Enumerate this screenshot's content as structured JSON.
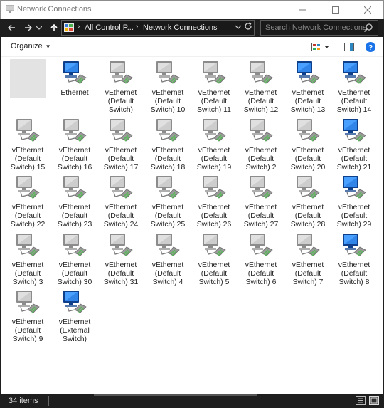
{
  "window": {
    "title": "Network Connections"
  },
  "addressbar": {
    "crumbs": [
      "All Control P...",
      "Network Connections"
    ],
    "search_placeholder": "Search Network Connections"
  },
  "toolbar": {
    "organize_label": "Organize"
  },
  "items": [
    {
      "label": "",
      "state": "selected-blank"
    },
    {
      "label": "Ethernet",
      "state": "connected"
    },
    {
      "label": "vEthernet (Default Switch)",
      "state": "disabled"
    },
    {
      "label": "vEthernet (Default Switch) 10",
      "state": "disabled"
    },
    {
      "label": "vEthernet (Default Switch) 11",
      "state": "disabled"
    },
    {
      "label": "vEthernet (Default Switch) 12",
      "state": "disabled"
    },
    {
      "label": "vEthernet (Default Switch) 13",
      "state": "connected"
    },
    {
      "label": "vEthernet (Default Switch) 14",
      "state": "connected"
    },
    {
      "label": "vEthernet (Default Switch) 15",
      "state": "disabled"
    },
    {
      "label": "vEthernet (Default Switch) 16",
      "state": "disabled"
    },
    {
      "label": "vEthernet (Default Switch) 17",
      "state": "disabled"
    },
    {
      "label": "vEthernet (Default Switch) 18",
      "state": "disabled"
    },
    {
      "label": "vEthernet (Default Switch) 19",
      "state": "disabled"
    },
    {
      "label": "vEthernet (Default Switch) 2",
      "state": "disabled"
    },
    {
      "label": "vEthernet (Default Switch) 20",
      "state": "disabled"
    },
    {
      "label": "vEthernet (Default Switch) 21",
      "state": "connected"
    },
    {
      "label": "vEthernet (Default Switch) 22",
      "state": "disabled"
    },
    {
      "label": "vEthernet (Default Switch) 23",
      "state": "disabled"
    },
    {
      "label": "vEthernet (Default Switch) 24",
      "state": "disabled"
    },
    {
      "label": "vEthernet (Default Switch) 25",
      "state": "disabled"
    },
    {
      "label": "vEthernet (Default Switch) 26",
      "state": "disabled"
    },
    {
      "label": "vEthernet (Default Switch) 27",
      "state": "disabled"
    },
    {
      "label": "vEthernet (Default Switch) 28",
      "state": "disabled"
    },
    {
      "label": "vEthernet (Default Switch) 29",
      "state": "connected"
    },
    {
      "label": "vEthernet (Default Switch) 3",
      "state": "disabled"
    },
    {
      "label": "vEthernet (Default Switch) 30",
      "state": "disabled"
    },
    {
      "label": "vEthernet (Default Switch) 31",
      "state": "disabled"
    },
    {
      "label": "vEthernet (Default Switch) 4",
      "state": "disabled"
    },
    {
      "label": "vEthernet (Default Switch) 5",
      "state": "disabled"
    },
    {
      "label": "vEthernet (Default Switch) 6",
      "state": "disabled"
    },
    {
      "label": "vEthernet (Default Switch) 7",
      "state": "disabled"
    },
    {
      "label": "vEthernet (Default Switch) 8",
      "state": "connected"
    },
    {
      "label": "vEthernet (Default Switch) 9",
      "state": "disabled"
    },
    {
      "label": "vEthernet (External Switch)",
      "state": "connected"
    }
  ],
  "statusbar": {
    "item_count": "34 items"
  },
  "colors": {
    "monitor_connected": "#1f6fd6",
    "monitor_disabled": "#bdbdbd",
    "chrome_dark": "#1e1e1e",
    "help_blue": "#1a73e8"
  }
}
